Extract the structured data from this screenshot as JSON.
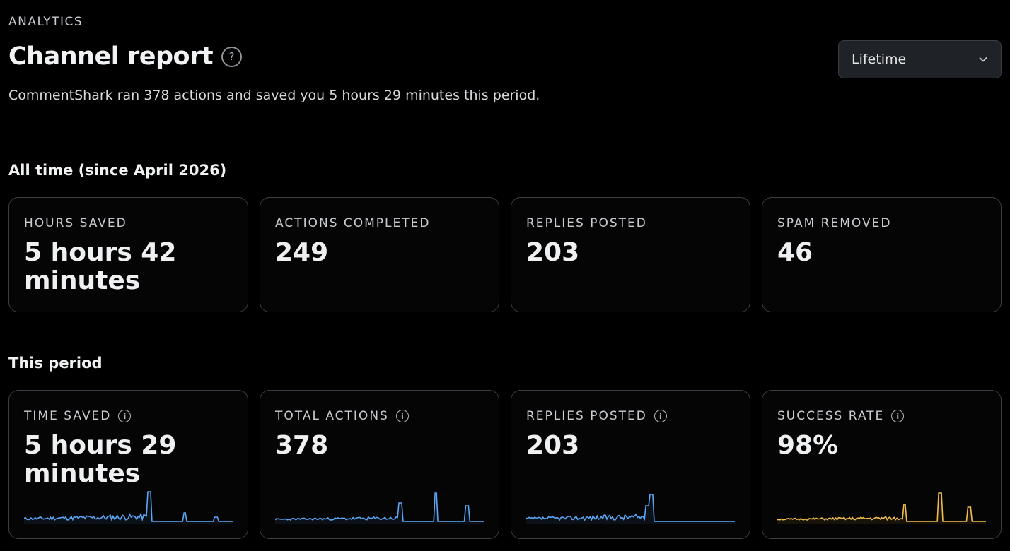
{
  "header": {
    "eyebrow": "ANALYTICS",
    "title": "Channel report",
    "help_icon": "?",
    "subtitle": "CommentShark ran 378 actions and saved you 5 hours 29 minutes this period."
  },
  "period_select": {
    "value": "Lifetime",
    "icon": "chevron-down-icon"
  },
  "all_time": {
    "title": "All time (since April 2026)",
    "cards": [
      {
        "label": "HOURS SAVED",
        "value": "5 hours 42 minutes"
      },
      {
        "label": "ACTIONS COMPLETED",
        "value": "249"
      },
      {
        "label": "REPLIES POSTED",
        "value": "203"
      },
      {
        "label": "SPAM REMOVED",
        "value": "46"
      }
    ]
  },
  "this_period": {
    "title": "This period",
    "info_icon": "i",
    "cards": [
      {
        "label": "TIME SAVED",
        "value": "5 hours 29 minutes",
        "color": "#5aa6f5"
      },
      {
        "label": "TOTAL ACTIONS",
        "value": "378",
        "color": "#5aa6f5"
      },
      {
        "label": "REPLIES POSTED",
        "value": "203",
        "color": "#5aa6f5"
      },
      {
        "label": "SUCCESS RATE",
        "value": "98%",
        "color": "#f0bd4c"
      }
    ]
  },
  "colors": {
    "accent_blue": "#5aa6f5",
    "accent_amber": "#f0bd4c",
    "background": "#000000"
  }
}
